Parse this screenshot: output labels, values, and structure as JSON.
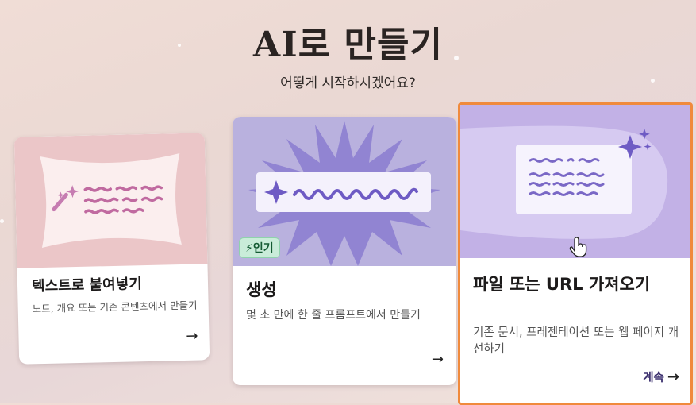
{
  "header": {
    "title": "AI로 만들기",
    "subtitle": "어떻게 시작하시겠어요?"
  },
  "cards": [
    {
      "heading": "텍스트로 붙여넣기",
      "description": "노트, 개요 또는 기존 콘텐츠에서 만들기",
      "arrow": "→",
      "icon": "wand-icon"
    },
    {
      "heading": "생성",
      "description": "몇 초 만에 한 줄 프롬프트에서 만들기",
      "badge": "인기",
      "badge_icon": "lightning-icon",
      "arrow": "→",
      "icon": "sparkle-icon"
    },
    {
      "heading": "파일 또는 URL 가져오기",
      "description": "기존 문서, 프레젠테이션 또는 웹 페이지 개선하기",
      "continue_label": "계속",
      "arrow": "→",
      "icon": "sparkle-icon"
    }
  ],
  "colors": {
    "selected_border": "#f08a3c",
    "paste_art": "#ebc6c8",
    "generate_art": "#b9b1de",
    "import_art": "#c2b1e6",
    "badge_bg": "#c9ecd9"
  }
}
